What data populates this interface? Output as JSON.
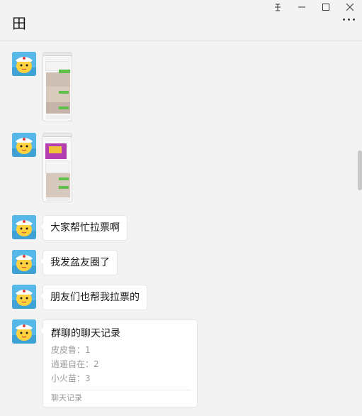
{
  "window": {
    "controls": [
      "pin-icon",
      "minimize-icon",
      "maximize-icon",
      "close-icon"
    ]
  },
  "header": {
    "title": "田",
    "more_icon": "more-icon"
  },
  "messages": [
    {
      "type": "image",
      "avatar": "avatar"
    },
    {
      "type": "image",
      "avatar": "avatar"
    },
    {
      "type": "text",
      "text": "大家帮忙拉票啊"
    },
    {
      "type": "text",
      "text": "我发盆友圈了"
    },
    {
      "type": "text",
      "text": "朋友们也帮我拉票的"
    },
    {
      "type": "chat-record",
      "title": "群聊的聊天记录",
      "lines": [
        "皮皮鲁：1",
        "逍遥自在：2",
        "小火苗：3"
      ],
      "footer": "聊天记录"
    }
  ],
  "colors": {
    "background": "#f3f3f3",
    "bubble": "#ffffff",
    "accent_green": "#5fbf4b",
    "muted_text": "#9a9a9a"
  }
}
